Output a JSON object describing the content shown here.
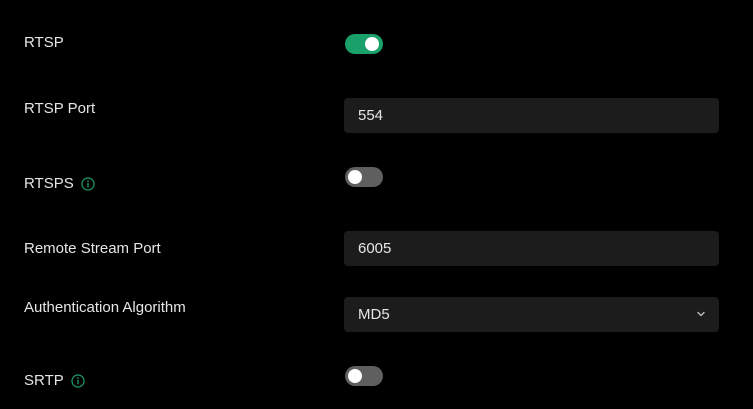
{
  "settings": {
    "rtsp": {
      "label": "RTSP",
      "enabled": true
    },
    "rtsp_port": {
      "label": "RTSP Port",
      "value": "554"
    },
    "rtsps": {
      "label": "RTSPS",
      "enabled": false,
      "icon": "info-icon"
    },
    "remote_stream_port": {
      "label": "Remote Stream Port",
      "value": "6005"
    },
    "auth_algorithm": {
      "label": "Authentication Algorithm",
      "selected": "MD5",
      "icon": "chevron-down-icon"
    },
    "srtp": {
      "label": "SRTP",
      "enabled": false,
      "icon": "info-icon"
    }
  },
  "colors": {
    "background": "#000000",
    "toggle_on": "#1aa16a",
    "toggle_off": "#5f5f5f",
    "field_bg": "#1c1c1c",
    "info_icon": "#1aa16a"
  }
}
